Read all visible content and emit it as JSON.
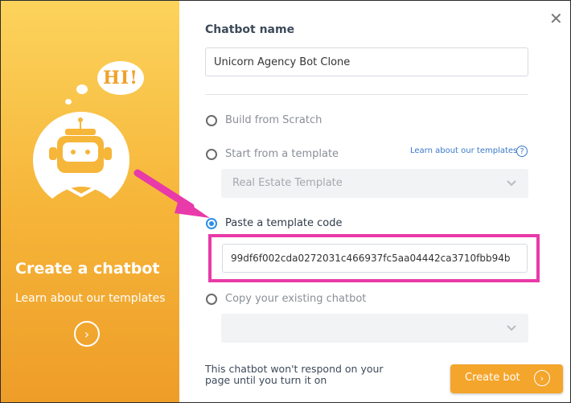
{
  "promo": {
    "bubble_text": "HI!",
    "title": "Create a chatbot",
    "subtitle": "Learn about our templates",
    "next_icon": "›"
  },
  "dialog": {
    "close_icon": "✕",
    "name_label": "Chatbot name",
    "name_value": "Unicorn Agency Bot Clone",
    "options": {
      "scratch": "Build from Scratch",
      "template": "Start from a template",
      "paste": "Paste a template code",
      "copy": "Copy your existing chatbot"
    },
    "selected_option": "paste",
    "learn_link": "Learn about our templates",
    "help_icon": "?",
    "template_select_value": "Real Estate Template",
    "template_code_value": "99df6f002cda0272031c466937fc5aa04442ca3710fbb94b",
    "copy_select_value": "",
    "footnote": "This chatbot won't respond on your page until you turn it on",
    "create_button": "Create bot",
    "create_button_icon": "›"
  },
  "colors": {
    "accent_orange": "#f4a52b",
    "highlight_pink": "#e83aa8",
    "radio_blue": "#2d8fe6",
    "link_blue": "#3a79c8"
  }
}
